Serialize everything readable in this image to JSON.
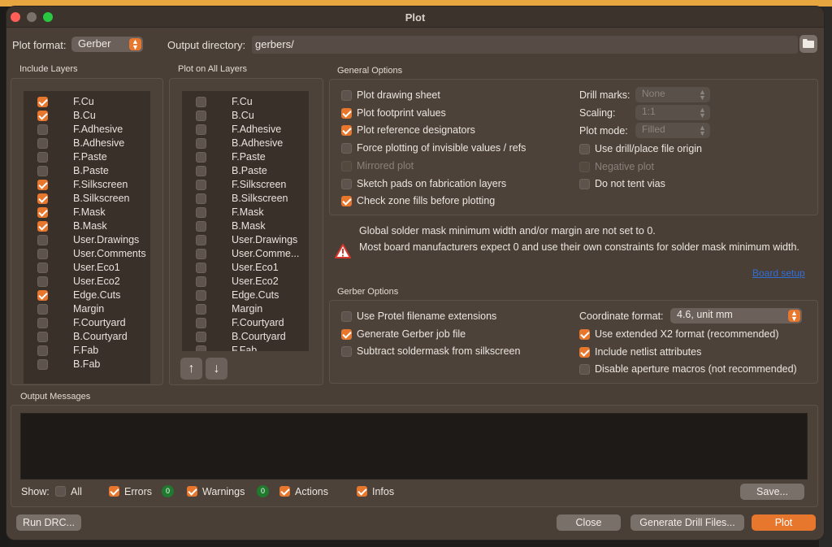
{
  "window": {
    "title": "Plot"
  },
  "plot_format": {
    "label": "Plot format:",
    "value": "Gerber"
  },
  "output_directory": {
    "label": "Output directory:",
    "value": "gerbers/"
  },
  "include_layers": {
    "title": "Include Layers",
    "items": [
      {
        "name": "F.Cu",
        "checked": true
      },
      {
        "name": "B.Cu",
        "checked": true
      },
      {
        "name": "F.Adhesive",
        "checked": false
      },
      {
        "name": "B.Adhesive",
        "checked": false
      },
      {
        "name": "F.Paste",
        "checked": false
      },
      {
        "name": "B.Paste",
        "checked": false
      },
      {
        "name": "F.Silkscreen",
        "checked": true
      },
      {
        "name": "B.Silkscreen",
        "checked": true
      },
      {
        "name": "F.Mask",
        "checked": true
      },
      {
        "name": "B.Mask",
        "checked": true
      },
      {
        "name": "User.Drawings",
        "checked": false
      },
      {
        "name": "User.Comments",
        "checked": false
      },
      {
        "name": "User.Eco1",
        "checked": false
      },
      {
        "name": "User.Eco2",
        "checked": false
      },
      {
        "name": "Edge.Cuts",
        "checked": true
      },
      {
        "name": "Margin",
        "checked": false
      },
      {
        "name": "F.Courtyard",
        "checked": false
      },
      {
        "name": "B.Courtyard",
        "checked": false
      },
      {
        "name": "F.Fab",
        "checked": false
      },
      {
        "name": "B.Fab",
        "checked": false
      }
    ]
  },
  "plot_on_all_layers": {
    "title": "Plot on All Layers",
    "items": [
      {
        "name": "F.Cu",
        "checked": false
      },
      {
        "name": "B.Cu",
        "checked": false
      },
      {
        "name": "F.Adhesive",
        "checked": false
      },
      {
        "name": "B.Adhesive",
        "checked": false
      },
      {
        "name": "F.Paste",
        "checked": false
      },
      {
        "name": "B.Paste",
        "checked": false
      },
      {
        "name": "F.Silkscreen",
        "checked": false
      },
      {
        "name": "B.Silkscreen",
        "checked": false
      },
      {
        "name": "F.Mask",
        "checked": false
      },
      {
        "name": "B.Mask",
        "checked": false
      },
      {
        "name": "User.Drawings",
        "checked": false
      },
      {
        "name": "User.Comme...",
        "checked": false
      },
      {
        "name": "User.Eco1",
        "checked": false
      },
      {
        "name": "User.Eco2",
        "checked": false
      },
      {
        "name": "Edge.Cuts",
        "checked": false
      },
      {
        "name": "Margin",
        "checked": false
      },
      {
        "name": "F.Courtyard",
        "checked": false
      },
      {
        "name": "B.Courtyard",
        "checked": false
      },
      {
        "name": "F.Fab",
        "checked": false
      }
    ],
    "up_icon": "arrow-up-icon",
    "down_icon": "arrow-down-icon"
  },
  "general_options": {
    "title": "General Options",
    "left": [
      {
        "label": "Plot drawing sheet",
        "checked": false,
        "enabled": true
      },
      {
        "label": "Plot footprint values",
        "checked": true,
        "enabled": true
      },
      {
        "label": "Plot reference designators",
        "checked": true,
        "enabled": true
      },
      {
        "label": "Force plotting of invisible values / refs",
        "checked": false,
        "enabled": true
      },
      {
        "label": "Mirrored plot",
        "checked": false,
        "enabled": false
      },
      {
        "label": "Sketch pads on fabrication layers",
        "checked": false,
        "enabled": true
      },
      {
        "label": "Check zone fills before plotting",
        "checked": true,
        "enabled": true
      }
    ],
    "drill_marks": {
      "label": "Drill marks:",
      "value": "None"
    },
    "scaling": {
      "label": "Scaling:",
      "value": "1:1"
    },
    "plot_mode": {
      "label": "Plot mode:",
      "value": "Filled"
    },
    "right": [
      {
        "label": "Use drill/place file origin",
        "checked": false,
        "enabled": true
      },
      {
        "label": "Negative plot",
        "checked": false,
        "enabled": false
      },
      {
        "label": "Do not tent vias",
        "checked": false,
        "enabled": true
      }
    ]
  },
  "warning": {
    "icon": "warning-icon",
    "line1": "Global solder mask minimum width and/or margin are not set to 0.",
    "line2": "Most board manufacturers expect 0 and use their own constraints for solder mask minimum width.",
    "link": "Board setup"
  },
  "gerber_options": {
    "title": "Gerber Options",
    "left": [
      {
        "label": "Use Protel filename extensions",
        "checked": false
      },
      {
        "label": "Generate Gerber job file",
        "checked": true
      },
      {
        "label": "Subtract soldermask from silkscreen",
        "checked": false
      }
    ],
    "coordinate_format": {
      "label": "Coordinate format:",
      "value": "4.6, unit mm"
    },
    "right": [
      {
        "label": "Use extended X2 format (recommended)",
        "checked": true
      },
      {
        "label": "Include netlist attributes",
        "checked": true
      },
      {
        "label": "Disable aperture macros (not recommended)",
        "checked": false
      }
    ]
  },
  "output_messages": {
    "title": "Output Messages",
    "show_label": "Show:",
    "filters": [
      {
        "label": "All",
        "checked": false
      },
      {
        "label": "Errors",
        "checked": true,
        "count": "0"
      },
      {
        "label": "Warnings",
        "checked": true,
        "count": "0"
      },
      {
        "label": "Actions",
        "checked": true
      },
      {
        "label": "Infos",
        "checked": true
      }
    ],
    "save_label": "Save..."
  },
  "buttons": {
    "run_drc": "Run DRC...",
    "close": "Close",
    "generate_drill": "Generate Drill Files...",
    "plot": "Plot"
  },
  "colors": {
    "accent": "#e8772e",
    "dialog_bg": "#4a3f37",
    "badge": "#1f7a2e",
    "link": "#2f6fd8"
  }
}
